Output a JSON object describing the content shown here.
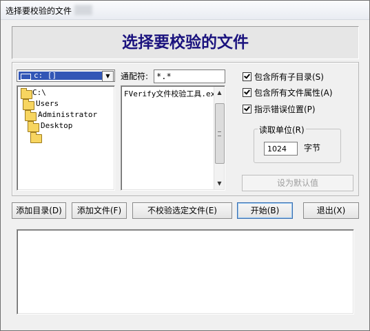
{
  "window": {
    "title": "选择要校验的文件"
  },
  "banner": {
    "title": "选择要校验的文件"
  },
  "drive": {
    "selected": "c: []"
  },
  "folders": [
    {
      "label": "C:\\",
      "level": 0
    },
    {
      "label": "Users",
      "level": 1
    },
    {
      "label": "Administrator",
      "level": 2
    },
    {
      "label": "Desktop",
      "level": 3
    },
    {
      "label": "",
      "level": 3
    }
  ],
  "pattern": {
    "label": "通配符:",
    "value": "*.*"
  },
  "files": [
    "FVerify文件校验工具.exe"
  ],
  "options": {
    "include_subdirs": "包含所有子目录(S)",
    "include_attrs": "包含所有文件属性(A)",
    "show_error_pos": "指示错误位置(P)"
  },
  "read_unit": {
    "legend": "读取单位(R)",
    "value": "1024",
    "unit": "字节"
  },
  "buttons": {
    "set_default": "设为默认值",
    "add_dir": "添加目录(D)",
    "add_file": "添加文件(F)",
    "no_verify": "不校验选定文件(E)",
    "start": "开始(B)",
    "exit": "退出(X)"
  },
  "colors": {
    "banner_text": "#1b137e",
    "selection": "#3256b6",
    "folder": "#f7d560"
  },
  "icons": [
    "folder-icon",
    "drive-icon",
    "dropdown-arrow-icon",
    "scroll-up-arrow-icon",
    "scroll-down-arrow-icon",
    "checkmark-icon"
  ]
}
